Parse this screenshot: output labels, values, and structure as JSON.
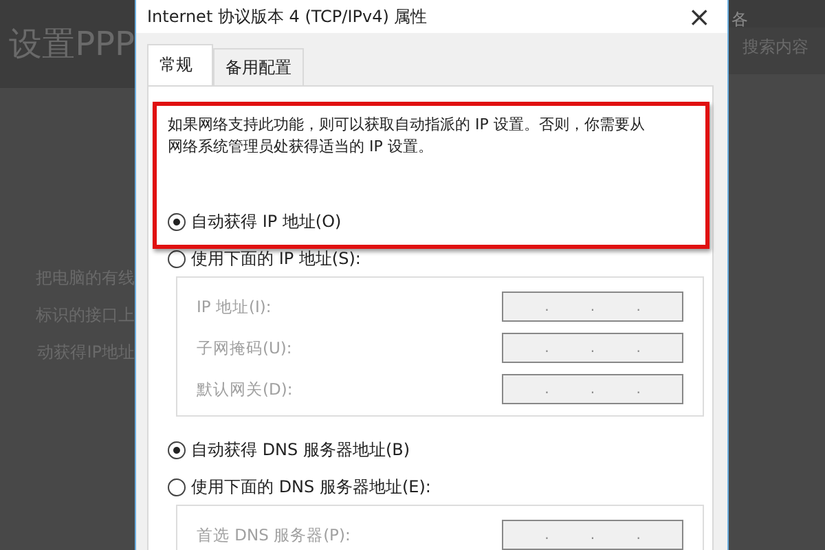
{
  "background_left": {
    "title": "设置PPP",
    "lines": [
      "把电脑的有线",
      "标识的接口上",
      "动获得IP地址"
    ]
  },
  "background_right": {
    "texts": [
      "各",
      "搜索内容"
    ]
  },
  "window": {
    "title": "Internet 协议版本 4 (TCP/IPv4) 属性",
    "close": "×"
  },
  "tabs": [
    {
      "label": "常规",
      "selected": true
    },
    {
      "label": "备用配置",
      "selected": false
    }
  ],
  "description": "如果网络支持此功能，则可以获取自动指派的 IP 设置。否则，你需要从网络系统管理员处获得适当的 IP 设置。",
  "ip_options": [
    {
      "label": "自动获得 IP 地址(O)",
      "selected": true
    },
    {
      "label": "使用下面的 IP 地址(S):",
      "selected": false
    }
  ],
  "ip_fields": [
    {
      "label": "IP 地址(I):",
      "separator": ".",
      "disabled": true
    },
    {
      "label": "子网掩码(U):",
      "separator": ".",
      "disabled": true
    },
    {
      "label": "默认网关(D):",
      "separator": ".",
      "disabled": true
    }
  ],
  "dns_options": [
    {
      "label": "自动获得 DNS 服务器地址(B)",
      "selected": true
    },
    {
      "label": "使用下面的 DNS 服务器地址(E):",
      "selected": false
    }
  ],
  "dns_fields": [
    {
      "label": "首选 DNS 服务器(P):",
      "separator": ".",
      "disabled": true
    }
  ]
}
